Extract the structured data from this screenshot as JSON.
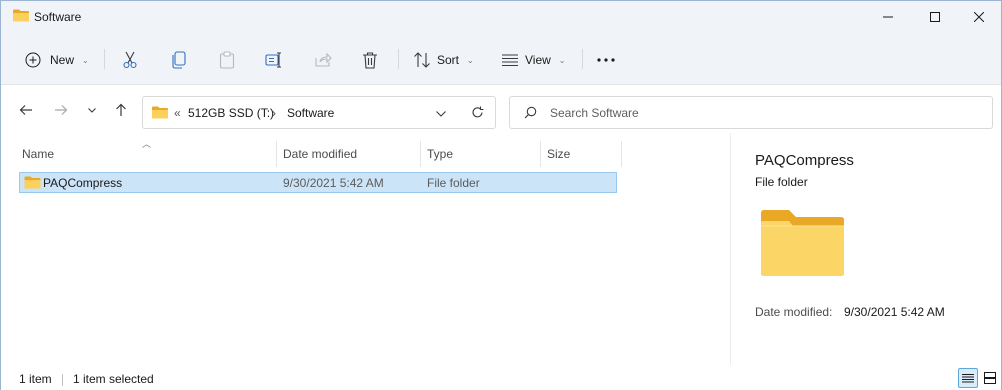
{
  "window": {
    "title": "Software"
  },
  "toolbar": {
    "new_label": "New",
    "sort_label": "Sort",
    "view_label": "View"
  },
  "address": {
    "overflow": "«",
    "drive": "512GB SSD (T:)",
    "separator": "›",
    "folder": "Software"
  },
  "search": {
    "placeholder": "Search Software"
  },
  "columns": {
    "name": "Name",
    "date": "Date modified",
    "type": "Type",
    "size": "Size"
  },
  "rows": [
    {
      "name": "PAQCompress",
      "date": "9/30/2021 5:42 AM",
      "type": "File folder",
      "size": ""
    }
  ],
  "preview": {
    "title": "PAQCompress",
    "subtitle": "File folder",
    "date_label": "Date modified:",
    "date_value": "9/30/2021 5:42 AM"
  },
  "status": {
    "count": "1 item",
    "selected": "1 item selected"
  },
  "colors": {
    "selection": "#cce4f7",
    "folder": "#f8c642",
    "chrome": "#f0f4f9"
  }
}
